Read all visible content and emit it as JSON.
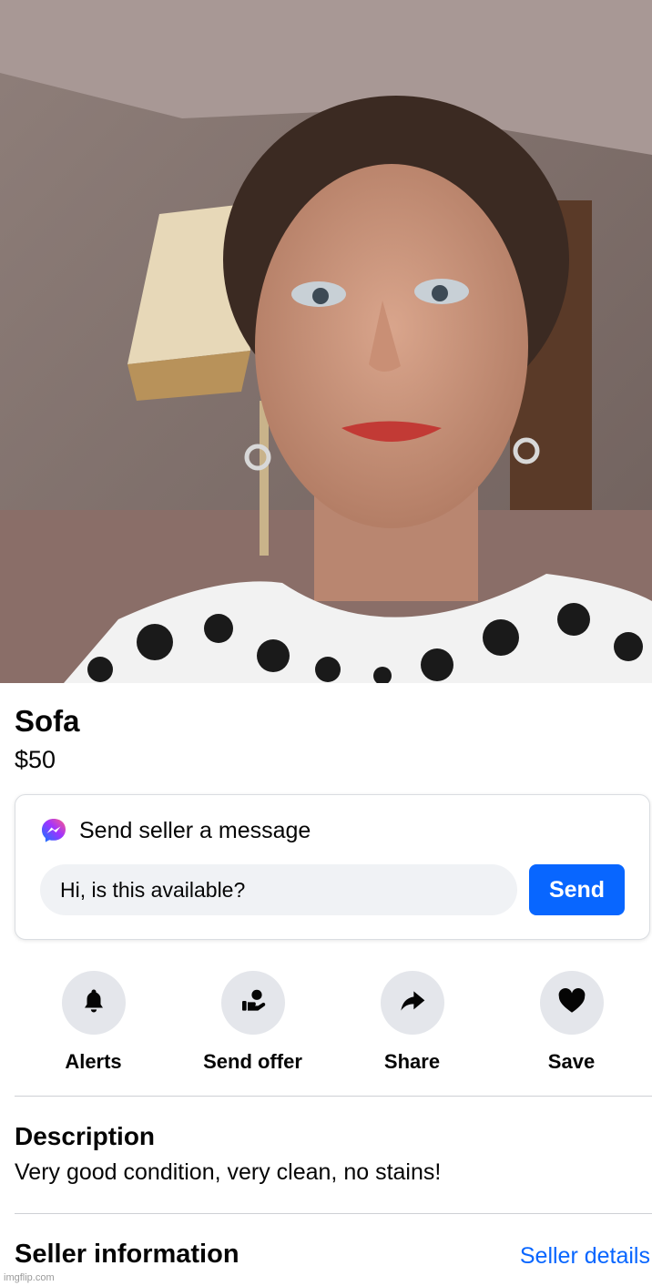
{
  "listing": {
    "title": "Sofa",
    "price": "$50"
  },
  "message_card": {
    "icon": "messenger-icon",
    "heading": "Send seller a message",
    "input_value": "Hi, is this available?",
    "send_label": "Send",
    "accent": "#0866ff"
  },
  "actions": [
    {
      "label": "Alerts",
      "icon": "bell-icon"
    },
    {
      "label": "Send offer",
      "icon": "offer-hand-icon"
    },
    {
      "label": "Share",
      "icon": "share-arrow-icon"
    },
    {
      "label": "Save",
      "icon": "heart-icon"
    }
  ],
  "description": {
    "heading": "Description",
    "text": "Very good condition, very clean, no stains!"
  },
  "seller": {
    "heading": "Seller information",
    "link": "Seller details"
  },
  "watermark": "imgflip.com"
}
